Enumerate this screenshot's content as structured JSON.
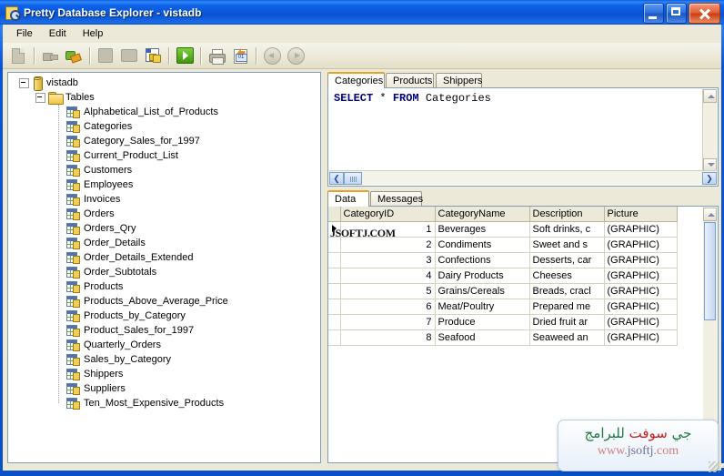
{
  "window": {
    "title": "Pretty Database Explorer - vistadb",
    "icon": "database-magnifier-icon",
    "buttons": {
      "minimize": "Minimize",
      "maximize": "Maximize",
      "close": "Close"
    }
  },
  "menu": {
    "items": [
      "File",
      "Edit",
      "Help"
    ]
  },
  "toolbar": {
    "buttons": [
      {
        "name": "new-document-icon",
        "title": "New",
        "enabled": false
      },
      {
        "name": "disconnect-icon",
        "title": "Disconnect",
        "enabled": false
      },
      {
        "name": "connect-icon",
        "title": "Connect",
        "enabled": true
      },
      {
        "name": "cut-icon",
        "title": "Cut",
        "enabled": false
      },
      {
        "name": "copy-icon",
        "title": "Copy",
        "enabled": false
      },
      {
        "name": "table-designer-icon",
        "title": "Table",
        "enabled": true
      },
      {
        "name": "execute-icon",
        "title": "Execute",
        "enabled": true
      },
      {
        "name": "print-icon",
        "title": "Print",
        "enabled": true
      },
      {
        "name": "report-icon",
        "title": "Report",
        "enabled": true
      },
      {
        "name": "back-icon",
        "title": "Back",
        "enabled": false
      },
      {
        "name": "forward-icon",
        "title": "Forward",
        "enabled": false
      }
    ]
  },
  "tree": {
    "root": {
      "label": "vistadb",
      "icon": "database-icon",
      "expanded": true
    },
    "folder": {
      "label": "Tables",
      "icon": "folder-icon",
      "expanded": true
    },
    "tables": [
      "Alphabetical_List_of_Products",
      "Categories",
      "Category_Sales_for_1997",
      "Current_Product_List",
      "Customers",
      "Employees",
      "Invoices",
      "Orders",
      "Orders_Qry",
      "Order_Details",
      "Order_Details_Extended",
      "Order_Subtotals",
      "Products",
      "Products_Above_Average_Price",
      "Products_by_Category",
      "Product_Sales_for_1997",
      "Quarterly_Orders",
      "Sales_by_Category",
      "Shippers",
      "Suppliers",
      "Ten_Most_Expensive_Products"
    ]
  },
  "query_tabs": {
    "items": [
      "Categories",
      "Products",
      "Shippers"
    ],
    "active": "Categories"
  },
  "editor": {
    "sql_keyword1": "SELECT",
    "sql_star": " * ",
    "sql_keyword2": "FROM",
    "sql_table": " Categories",
    "full_text": "SELECT * FROM Categories"
  },
  "result_tabs": {
    "items": [
      "Data",
      "Messages"
    ],
    "active": "Data"
  },
  "grid": {
    "columns": [
      "CategoryID",
      "CategoryName",
      "Description",
      "Picture"
    ],
    "rows": [
      {
        "id": "1",
        "name": "Beverages",
        "description": "Soft drinks, c",
        "picture": "(GRAPHIC)",
        "selected": true
      },
      {
        "id": "2",
        "name": "Condiments",
        "description": "Sweet and s",
        "picture": "(GRAPHIC)",
        "selected": false
      },
      {
        "id": "3",
        "name": "Confections",
        "description": "Desserts, car",
        "picture": "(GRAPHIC)",
        "selected": false
      },
      {
        "id": "4",
        "name": "Dairy Products",
        "description": "Cheeses",
        "picture": "(GRAPHIC)",
        "selected": false
      },
      {
        "id": "5",
        "name": "Grains/Cereals",
        "description": "Breads, cracl",
        "picture": "(GRAPHIC)",
        "selected": false
      },
      {
        "id": "6",
        "name": "Meat/Poultry",
        "description": "Prepared me",
        "picture": "(GRAPHIC)",
        "selected": false
      },
      {
        "id": "7",
        "name": "Produce",
        "description": "Dried fruit ar",
        "picture": "(GRAPHIC)",
        "selected": false
      },
      {
        "id": "8",
        "name": "Seafood",
        "description": "Seaweed an",
        "picture": "(GRAPHIC)",
        "selected": false
      }
    ]
  },
  "watermarks": {
    "grid_overlay": "JSOFTJ.COM",
    "badge_arabic_green": "جي ",
    "badge_arabic_red": "سوفت",
    "badge_arabic_green2": " للبرامج",
    "badge_url_pre": "www.",
    "badge_url_mid": "jsoftj",
    "badge_url_post": ".com"
  },
  "colors": {
    "title_blue": "#0a52d8",
    "face": "#ece9d8",
    "tab_accent": "#e9a227",
    "field_border": "#7f9db9"
  }
}
